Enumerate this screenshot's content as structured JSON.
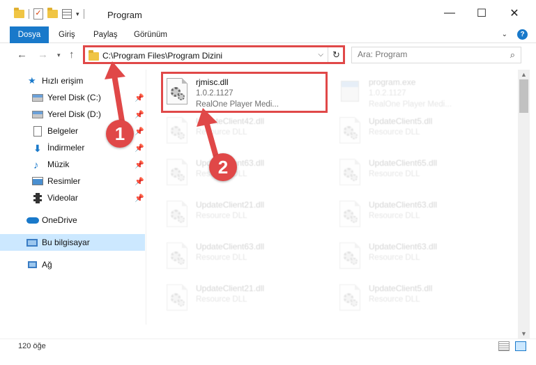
{
  "window": {
    "title": "Program",
    "minimize_glyph": "—",
    "maximize_glyph": "☐",
    "close_glyph": "✕"
  },
  "ribbon": {
    "tabs": [
      {
        "label": "Dosya",
        "active": true
      },
      {
        "label": "Giriş"
      },
      {
        "label": "Paylaş"
      },
      {
        "label": "Görünüm"
      }
    ]
  },
  "navigation": {
    "address_path": "C:\\Program Files\\Program Dizini",
    "search_placeholder": "Ara: Program"
  },
  "sidebar": {
    "items": [
      {
        "label": "Hızlı erişim",
        "icon": "star-icon"
      },
      {
        "label": "Yerel Disk (C:)",
        "icon": "drive-icon",
        "pinned": true
      },
      {
        "label": "Yerel Disk (D:)",
        "icon": "drive-icon",
        "pinned": true
      },
      {
        "label": "Belgeler",
        "icon": "document-icon",
        "pinned": true
      },
      {
        "label": "İndirmeler",
        "icon": "download-icon",
        "pinned": true
      },
      {
        "label": "Müzik",
        "icon": "music-icon",
        "pinned": true
      },
      {
        "label": "Resimler",
        "icon": "pictures-icon",
        "pinned": true
      },
      {
        "label": "Videolar",
        "icon": "videos-icon",
        "pinned": true
      },
      {
        "label": "OneDrive",
        "icon": "cloud-icon"
      },
      {
        "label": "Bu bilgisayar",
        "icon": "computer-icon",
        "selected": true
      },
      {
        "label": "Ağ",
        "icon": "network-icon"
      }
    ]
  },
  "files": [
    {
      "name": "rjmisc.dll",
      "version": "1.0.2.1127",
      "description": "RealOne Player Medi...",
      "icon": "dll-icon",
      "highlighted": true
    },
    {
      "name": "program.exe",
      "version": "1.0.2.1127",
      "description": "RealOne Player Medi...",
      "icon": "exe-icon"
    },
    {
      "name": "UpdateClient42.dll",
      "description": "Resource DLL",
      "icon": "dll-icon"
    },
    {
      "name": "UpdateClient5.dll",
      "description": "Resource DLL",
      "icon": "dll-icon"
    },
    {
      "name": "UpdateClient63.dll",
      "description": "Resource DLL",
      "icon": "dll-icon"
    },
    {
      "name": "UpdateClient65.dll",
      "description": "Resource DLL",
      "icon": "dll-icon"
    },
    {
      "name": "UpdateClient21.dll",
      "description": "Resource DLL",
      "icon": "dll-icon"
    },
    {
      "name": "UpdateClient63.dll",
      "description": "Resource DLL",
      "icon": "dll-icon"
    },
    {
      "name": "UpdateClient63.dll",
      "description": "Resource DLL",
      "icon": "dll-icon"
    },
    {
      "name": "UpdateClient63.dll",
      "description": "Resource DLL",
      "icon": "dll-icon"
    },
    {
      "name": "UpdateClient21.dll",
      "description": "Resource DLL",
      "icon": "dll-icon"
    },
    {
      "name": "UpdateClient5.dll",
      "description": "Resource DLL",
      "icon": "dll-icon"
    }
  ],
  "status": {
    "item_count": "120 öğe"
  },
  "annotations": {
    "step1": "1",
    "step2": "2",
    "color": "#e04848"
  },
  "colors": {
    "accent": "#1979ca",
    "selection": "#cce8ff"
  }
}
